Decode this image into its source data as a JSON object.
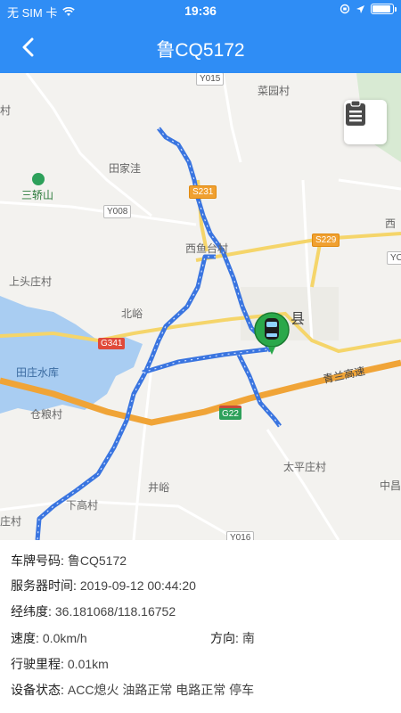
{
  "status_bar": {
    "carrier": "无 SIM 卡",
    "time": "19:36",
    "battery_level": 0.9
  },
  "nav": {
    "title": "鲁CQ5172",
    "back_icon": "chevron-left-icon"
  },
  "map": {
    "labels": {
      "caiyuancun": "菜园村",
      "tianjiawa": "田家洼",
      "sanjiaoshan": "三轿山",
      "xiyuquancun": "西鱼台村",
      "shangtouzhuangcun": "上头庄村",
      "beiyu": "北峪",
      "tianzhuangshuiku": "田庄水库",
      "canglangcun": "仓粮村",
      "qinglangaosu": "青兰高速",
      "taipingzhuangcun": "太平庄村",
      "jingyu": "井峪",
      "xiagaocun": "下高村",
      "xian": "县",
      "edge_cun": "村",
      "edge_xi": "西",
      "edge_zhong": "中昌",
      "edge_zhuangcun": "庄村"
    },
    "road_tags": {
      "y015": "Y015",
      "s231": "S231",
      "y008": "Y008",
      "s229": "S229",
      "yc": "YC",
      "g341": "G341",
      "g22": "G22",
      "y016": "Y016"
    },
    "clipboard_icon": "clipboard-icon",
    "vehicle_icon": "car-marker-icon"
  },
  "info": {
    "plate_label": "车牌号码:",
    "plate_value": "鲁CQ5172",
    "server_time_label": "服务器时间:",
    "server_time_value": "2019-09-12 00:44:20",
    "coords_label": "经纬度:",
    "coords_value": "36.181068/118.16752",
    "speed_label": "速度:",
    "speed_value": "0.0km/h",
    "direction_label": "方向:",
    "direction_value": "南",
    "mileage_label": "行驶里程:",
    "mileage_value": "0.01km",
    "device_status_label": "设备状态:",
    "device_status_value": "ACC熄火 油路正常 电路正常 停车"
  }
}
